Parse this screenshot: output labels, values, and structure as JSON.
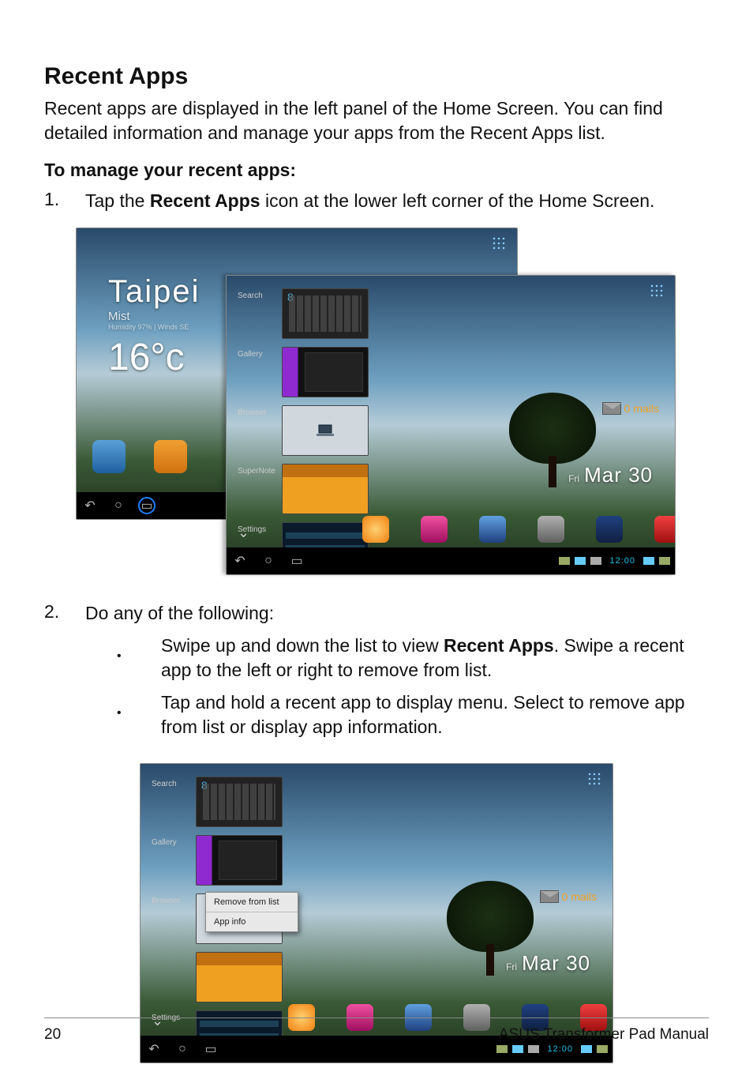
{
  "page": {
    "number": "20",
    "footer_title": "ASUS Transformer Pad Manual"
  },
  "section": {
    "title": "Recent Apps",
    "intro": "Recent apps are displayed in the left panel of the Home Screen. You can find detailed information and manage your apps from the Recent Apps list.",
    "subhead": "To manage your recent apps:",
    "step1_num": "1.",
    "step1_pre": "Tap the ",
    "step1_bold": "Recent Apps",
    "step1_post": " icon at the lower left corner of the Home Screen.",
    "step2_num": "2.",
    "step2_text": "Do any of the following:",
    "bullet1_pre": "Swipe up and down the list to view ",
    "bullet1_bold": "Recent Apps",
    "bullet1_post": ". Swipe a recent app to the left or right to remove from list.",
    "bullet2": "Tap and hold a recent app to display menu. Select to remove app from list or display app information."
  },
  "screenshot_home": {
    "weather": {
      "city": "Taipei",
      "condition": "Mist",
      "sub": "Humidity 97% | Winds SE",
      "temp": "16°c"
    },
    "nav": {
      "back": "↶",
      "home": "○",
      "recent": "▭"
    },
    "apps_row_icon_label": ""
  },
  "screenshot_recent": {
    "items": [
      {
        "label": "Search"
      },
      {
        "label": "Gallery"
      },
      {
        "label": "Browser"
      },
      {
        "label": "SuperNote"
      },
      {
        "label": "Settings"
      }
    ],
    "date": {
      "day": "Fri",
      "value": "Mar 30"
    },
    "mails": {
      "count": "0",
      "suffix": "mails"
    },
    "dock": [
      {
        "label": ""
      },
      {
        "label": ""
      },
      {
        "label": ""
      },
      {
        "label": ""
      },
      {
        "label": ""
      },
      {
        "label": ""
      }
    ],
    "status_time": "12:00",
    "context_menu": {
      "remove": "Remove from list",
      "info": "App info"
    }
  }
}
